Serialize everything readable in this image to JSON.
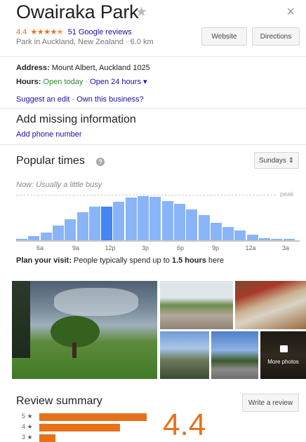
{
  "place": {
    "name": "Owairaka Park",
    "rating": "4.4",
    "stars": "★★★★✭",
    "reviews_link": "51 Google reviews",
    "subtitle": "Park in Auckland, New Zealand · 6.0 km"
  },
  "actions": {
    "website_label": "Website",
    "directions_label": "Directions",
    "close_glyph": "×",
    "favorite_glyph": "★"
  },
  "info": {
    "address_label": "Address:",
    "address_value": "Mount Albert, Auckland 1025",
    "hours_label": "Hours:",
    "hours_status": "Open today",
    "hours_sep": " · ",
    "hours_detail": "Open 24 hours ▾",
    "suggest_edit": "Suggest an edit",
    "link_sep": " · ",
    "own_business": "Own this business?"
  },
  "missing": {
    "title": "Add missing information",
    "add_phone": "Add phone number"
  },
  "popular_times": {
    "title": "Popular times",
    "help_glyph": "?",
    "day_selector": "Sundays ⇕",
    "now_text": "Now: Usually a little busy",
    "peak_label": "peak",
    "plan_label": "Plan your visit:",
    "plan_text": " People typically spend up to ",
    "plan_duration": "1.5 hours",
    "plan_tail": " here",
    "tick_labels": [
      "6a",
      "9a",
      "12p",
      "3p",
      "6p",
      "9p",
      "12a",
      "3a"
    ],
    "current_hour_index": 7,
    "busyness": [
      0.03,
      0.09,
      0.17,
      0.33,
      0.48,
      0.64,
      0.76,
      0.76,
      0.88,
      0.97,
      1.0,
      0.98,
      0.89,
      0.82,
      0.7,
      0.57,
      0.39,
      0.3,
      0.22,
      0.12,
      0.04,
      0.02,
      0.02
    ]
  },
  "photos": {
    "more_label": "More photos"
  },
  "review_summary": {
    "title": "Review summary",
    "write_review": "Write a review",
    "average": "4.4",
    "histogram": [
      {
        "stars": "5",
        "fraction": 1.0
      },
      {
        "stars": "4",
        "fraction": 0.75
      },
      {
        "stars": "3",
        "fraction": 0.15
      }
    ]
  },
  "colors": {
    "accent_orange": "#e7711b",
    "bar_blue": "#8ab4f8",
    "bar_current": "#4285f4",
    "link_blue": "#1a0dab",
    "open_green": "#2a8a2a"
  }
}
